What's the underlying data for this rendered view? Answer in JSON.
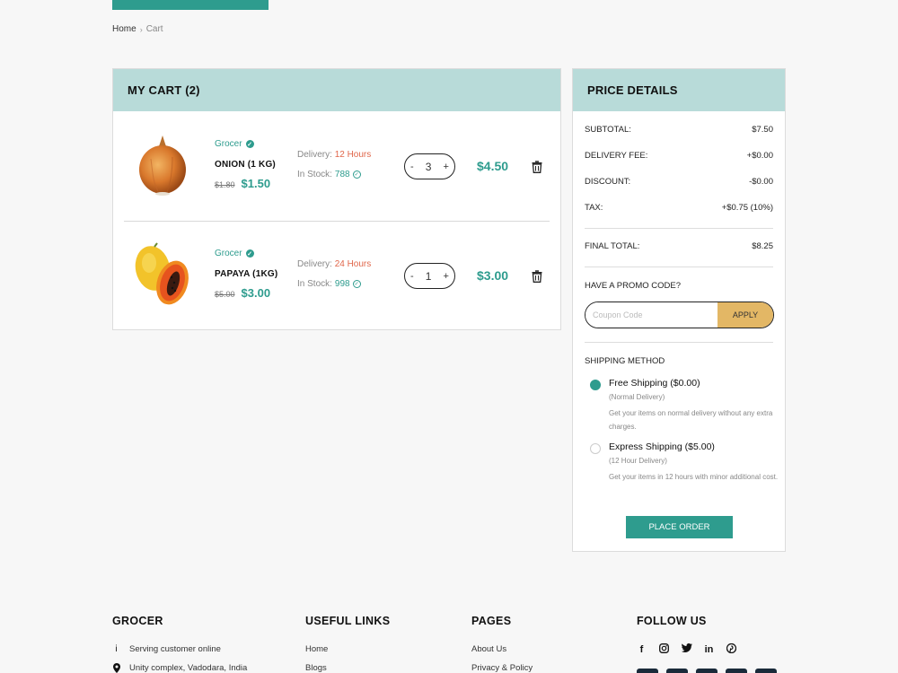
{
  "breadcrumb": {
    "home": "Home",
    "current": "Cart"
  },
  "cart": {
    "title": "MY CART (2)",
    "items": [
      {
        "brand": "Grocer",
        "name": "ONION (1 KG)",
        "old_price": "$1.80",
        "price": "$1.50",
        "delivery_label": "Delivery:",
        "delivery_time": "12 Hours",
        "stock_label": "In Stock:",
        "stock": "788",
        "qty": "3",
        "total": "$4.50"
      },
      {
        "brand": "Grocer",
        "name": "PAPAYA (1KG)",
        "old_price": "$5.00",
        "price": "$3.00",
        "delivery_label": "Delivery:",
        "delivery_time": "24 Hours",
        "stock_label": "In Stock:",
        "stock": "998",
        "qty": "1",
        "total": "$3.00"
      }
    ],
    "minus": "-",
    "plus": "+"
  },
  "price_details": {
    "title": "PRICE DETAILS",
    "subtotal_label": "SUBTOTAL:",
    "subtotal": "$7.50",
    "delivery_label": "DELIVERY FEE:",
    "delivery": "+$0.00",
    "discount_label": "DISCOUNT:",
    "discount": "-$0.00",
    "tax_label": "TAX:",
    "tax": "+$0.75 (10%)",
    "final_label": "FINAL TOTAL:",
    "final": "$8.25",
    "promo_label": "HAVE A PROMO CODE?",
    "promo_placeholder": "Coupon Code",
    "apply": "APPLY",
    "shipping_label": "SHIPPING METHOD",
    "shipping_options": [
      {
        "title": "Free Shipping ($0.00)",
        "sub": "(Normal Delivery)",
        "desc": "Get your items on normal delivery without any extra charges.",
        "selected": true
      },
      {
        "title": "Express Shipping ($5.00)",
        "sub": "(12 Hour Delivery)",
        "desc": "Get your items in 12 hours with minor additional cost.",
        "selected": false
      }
    ],
    "place_order": "PLACE ORDER"
  },
  "footer": {
    "grocer": {
      "title": "GROCER",
      "items": [
        "Serving customer online",
        "Unity complex, Vadodara, India"
      ]
    },
    "useful_links": {
      "title": "USEFUL LINKS",
      "items": [
        "Home",
        "Blogs"
      ]
    },
    "pages": {
      "title": "PAGES",
      "items": [
        "About Us",
        "Privacy & Policy"
      ]
    },
    "follow": {
      "title": "FOLLOW US",
      "icons": [
        "facebook-icon",
        "instagram-icon",
        "twitter-icon",
        "linkedin-icon",
        "pinterest-icon"
      ]
    }
  },
  "colors": {
    "accent": "#2e9c8e",
    "header_bg": "#b8dbd9",
    "apply_bg": "#e3b765",
    "delivery_highlight": "#e0664a"
  }
}
